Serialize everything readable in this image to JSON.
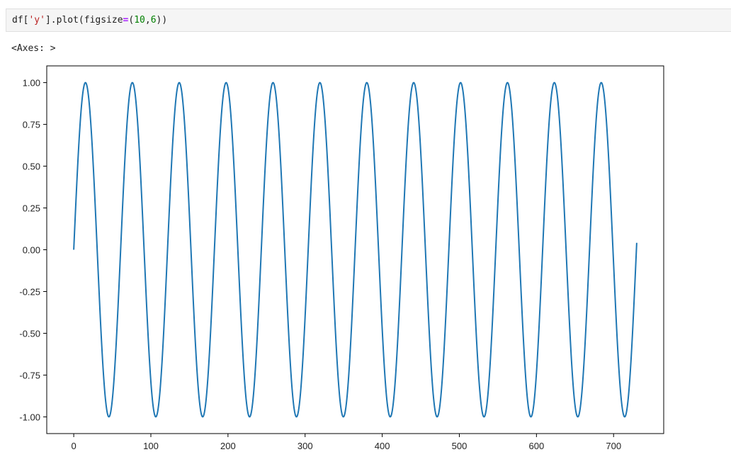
{
  "cell": {
    "code": {
      "prefix": "df[",
      "string": "'y'",
      "method": "].plot(figsize",
      "operator": "=",
      "open_paren": "(",
      "num1": "10",
      "comma": ",",
      "num2": "6",
      "close_paren": "))"
    }
  },
  "output": {
    "text": "<Axes: >"
  },
  "chart_data": {
    "type": "line",
    "title": "",
    "xlabel": "",
    "ylabel": "",
    "xlim": [
      -35,
      765
    ],
    "ylim": [
      -1.1,
      1.1
    ],
    "x_ticks": [
      0,
      100,
      200,
      300,
      400,
      500,
      600,
      700
    ],
    "x_tick_labels": [
      "0",
      "100",
      "200",
      "300",
      "400",
      "500",
      "600",
      "700"
    ],
    "y_ticks": [
      1.0,
      0.75,
      0.5,
      0.25,
      0.0,
      -0.25,
      -0.5,
      -0.75,
      -1.0
    ],
    "y_tick_labels": [
      "1.00",
      "0.75",
      "0.50",
      "0.25",
      "0.00",
      "-0.25",
      "-0.50",
      "-0.75",
      "-1.00"
    ],
    "grid": false,
    "series": [
      {
        "function": "sin",
        "x_start": 0,
        "x_end": 730,
        "period": 60.8,
        "color": "#1f77b4"
      }
    ]
  }
}
